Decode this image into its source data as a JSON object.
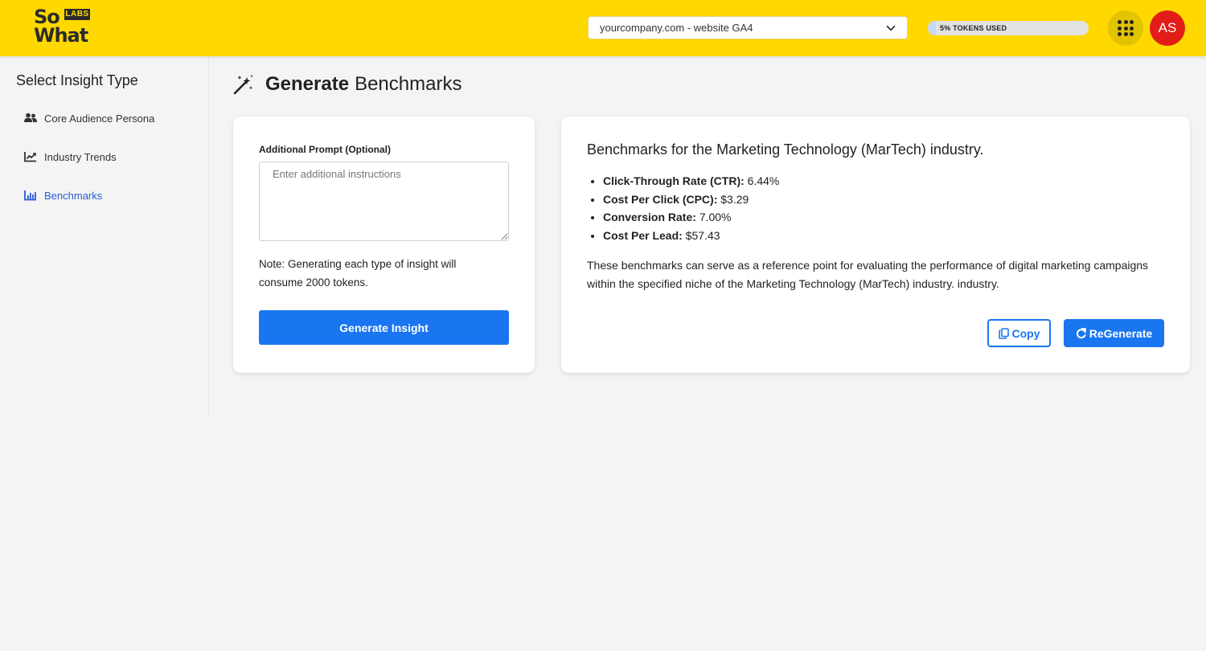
{
  "header": {
    "logo": {
      "line1": "So",
      "line2": "What",
      "badge": "LABS"
    },
    "property_select": {
      "value": "yourcompany.com - website GA4",
      "icon": "chevron-down-icon"
    },
    "tokens": {
      "label": "5% TOKENS USED",
      "percent_used": 5
    },
    "apps_icon": "grid-dots-icon",
    "avatar_initials": "AS",
    "colors": {
      "brand_yellow": "#ffd800",
      "avatar_red": "#e21d18"
    }
  },
  "sidebar": {
    "title": "Select Insight Type",
    "items": [
      {
        "label": "Core Audience Persona",
        "icon": "users-icon",
        "active": false
      },
      {
        "label": "Industry Trends",
        "icon": "trend-chart-icon",
        "active": false
      },
      {
        "label": "Benchmarks",
        "icon": "bar-chart-icon",
        "active": true
      }
    ],
    "active_color": "#2a5bd7"
  },
  "main": {
    "title_bold": "Generate",
    "title_rest": "Benchmarks",
    "title_icon": "magic-wand-icon",
    "form": {
      "label": "Additional Prompt (Optional)",
      "placeholder": "Enter additional instructions",
      "value": "",
      "note": "Note: Generating each type of insight will consume 2000 tokens.",
      "button_label": "Generate Insight"
    },
    "result": {
      "title": "Benchmarks for the Marketing Technology (MarTech) industry.",
      "metrics": [
        {
          "name": "Click-Through Rate (CTR):",
          "value": "6.44%"
        },
        {
          "name": "Cost Per Click (CPC):",
          "value": "$3.29"
        },
        {
          "name": "Conversion Rate:",
          "value": "7.00%"
        },
        {
          "name": "Cost Per Lead:",
          "value": "$57.43"
        }
      ],
      "summary": "These benchmarks can serve as a reference point for evaluating the performance of digital marketing campaigns within the specified niche of the Marketing Technology (MarTech) industry. industry.",
      "copy_label": "Copy",
      "regenerate_label": "ReGenerate"
    },
    "accent_color": "#1a76f0"
  }
}
